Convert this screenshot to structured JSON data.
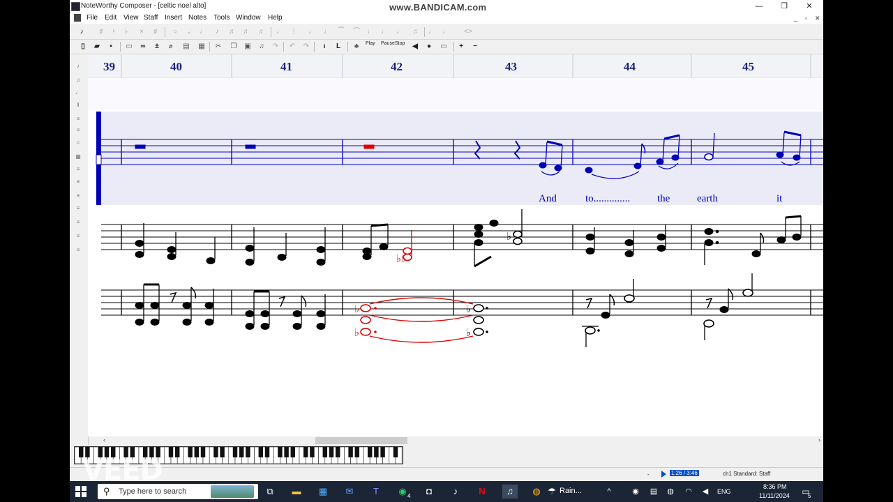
{
  "window": {
    "title": "NoteWorthy Composer - [celtic noel alto]",
    "watermark": "www.BANDICAM.com",
    "controls": [
      "—",
      "❐",
      "✕"
    ],
    "mdi_controls": [
      "_",
      "▫",
      "✕"
    ]
  },
  "menu": {
    "items": [
      "File",
      "Edit",
      "View",
      "Staff",
      "Insert",
      "Notes",
      "Tools",
      "Window",
      "Help"
    ]
  },
  "toolbar2": {
    "play_label": "Play",
    "pause_label": "Pause",
    "stop_label": "Stop"
  },
  "score": {
    "measure_numbers": [
      "39",
      "40",
      "41",
      "42",
      "43",
      "44",
      "45"
    ],
    "lyrics": [
      "And",
      "to..............",
      "the",
      "earth",
      "it"
    ],
    "colors": {
      "active_staff": "#0000b8",
      "selection": "#e00000",
      "measure_number": "#1a237e"
    }
  },
  "status": {
    "dash": "-",
    "time": "1:26 / 3:46",
    "staff_info": "ch1 Standard: Staff"
  },
  "overlay": {
    "veed": "VEED"
  },
  "taskbar": {
    "search_placeholder": "Type here to search",
    "whatsapp_badge": "4",
    "weather": "Rain...",
    "lang": "ENG",
    "time": "8:36 PM",
    "date": "11/11/2024",
    "notification_badge": "5"
  }
}
